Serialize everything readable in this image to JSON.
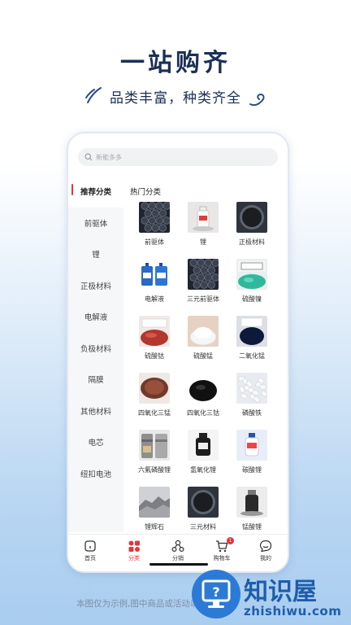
{
  "hero": {
    "headline": "一站购齐",
    "subline": "品类丰富，种类齐全"
  },
  "search": {
    "placeholder": "新能多多"
  },
  "sidebar": {
    "items": [
      {
        "label": "推荐分类",
        "active": true
      },
      {
        "label": "前驱体"
      },
      {
        "label": "锂"
      },
      {
        "label": "正极材料"
      },
      {
        "label": "电解液"
      },
      {
        "label": "负极材料"
      },
      {
        "label": "隔膜"
      },
      {
        "label": "其他材料"
      },
      {
        "label": "电芯"
      },
      {
        "label": "纽扣电池"
      }
    ]
  },
  "content": {
    "section_title": "热门分类",
    "products": [
      {
        "label": "前驱体",
        "icon": "dark-spheres"
      },
      {
        "label": "锂",
        "icon": "reagent-bottle"
      },
      {
        "label": "正极材料",
        "icon": "black-powder-dish"
      },
      {
        "label": "电解液",
        "icon": "blue-barrels"
      },
      {
        "label": "三元前驱体",
        "icon": "dark-spheres"
      },
      {
        "label": "硫酸镍",
        "icon": "green-crystals-bag"
      },
      {
        "label": "硫酸钴",
        "icon": "red-powder-bag"
      },
      {
        "label": "硫酸锰",
        "icon": "white-powder"
      },
      {
        "label": "二氧化锰",
        "icon": "black-powder-bag"
      },
      {
        "label": "四氧化三锰",
        "icon": "brown-powder-dish"
      },
      {
        "label": "四氧化三钴",
        "icon": "black-powder-pile"
      },
      {
        "label": "磷酸铁",
        "icon": "white-crystals"
      },
      {
        "label": "六氟磷酸锂",
        "icon": "steel-cylinders"
      },
      {
        "label": "氢氧化锂",
        "icon": "dark-bottle"
      },
      {
        "label": "碳酸锂",
        "icon": "white-bottle"
      },
      {
        "label": "锂辉石",
        "icon": "grey-rocks"
      },
      {
        "label": "三元材料",
        "icon": "black-powder-dish"
      },
      {
        "label": "锰酸锂",
        "icon": "black-powder-bottle"
      }
    ]
  },
  "tabbar": {
    "tabs": [
      {
        "label": "首页",
        "icon": "home-icon"
      },
      {
        "label": "分类",
        "icon": "category-icon",
        "active": true
      },
      {
        "label": "分销",
        "icon": "distribution-icon"
      },
      {
        "label": "购物车",
        "icon": "cart-icon",
        "badge": "1"
      },
      {
        "label": "我的",
        "icon": "profile-icon"
      }
    ]
  },
  "footer": {
    "disclaimer": "本图仅为示例,图中商品或活动以公示为准",
    "watermark_text": "知识屋",
    "watermark_url": "zhishiwu.com"
  },
  "colors": {
    "accent": "#e6333a",
    "navy": "#1b2f55",
    "watermark": "#1e5dab"
  }
}
